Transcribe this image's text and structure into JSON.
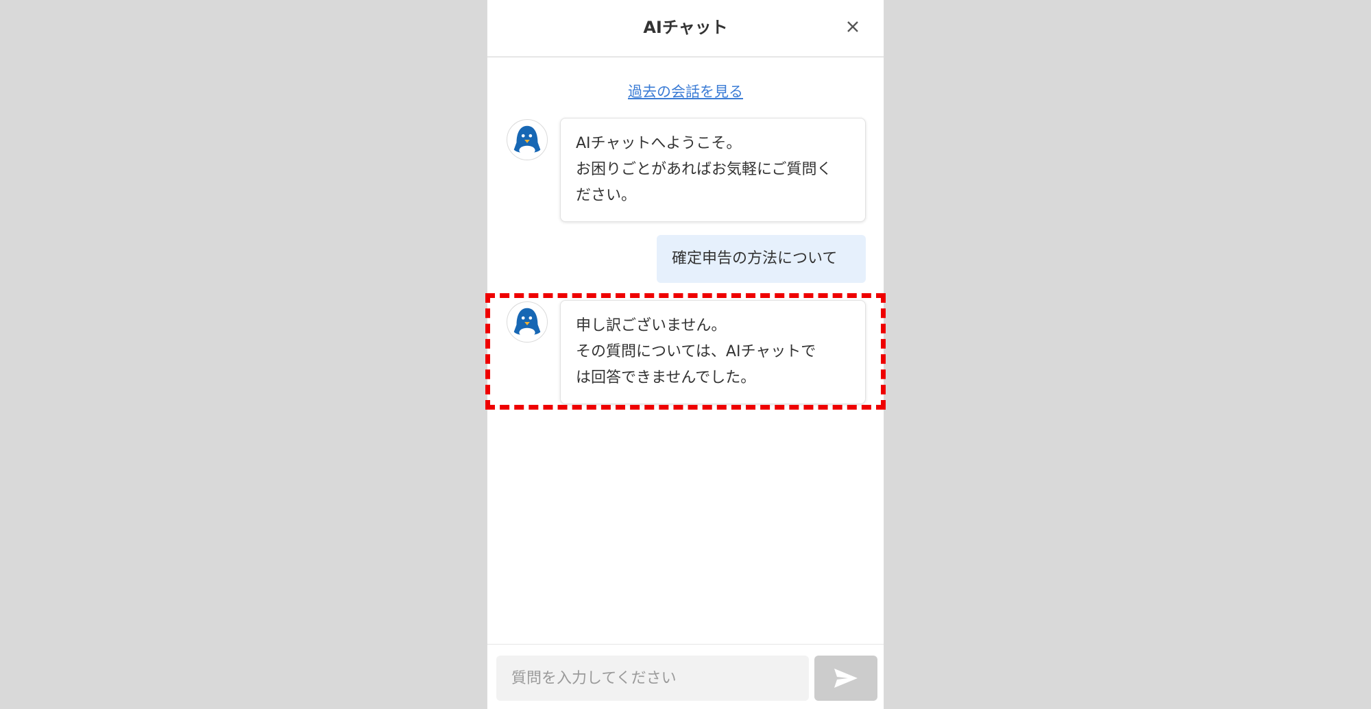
{
  "header": {
    "title": "AIチャット",
    "close_icon": "close-icon"
  },
  "history_link": "過去の会話を見る",
  "messages": [
    {
      "role": "bot",
      "avatar_icon": "penguin-avatar-icon",
      "lines": [
        "AIチャットへようこそ。",
        "お困りごとがあればお気軽にご質問く",
        "ださい。"
      ]
    },
    {
      "role": "user",
      "text": "確定申告の方法について"
    },
    {
      "role": "bot",
      "avatar_icon": "penguin-avatar-icon",
      "lines": [
        "申し訳ございません。",
        "その質問については、AIチャットで",
        "は回答できませんでした。"
      ],
      "highlighted": true
    }
  ],
  "input": {
    "placeholder": "質問を入力してください",
    "value": ""
  },
  "send_icon": "send-icon",
  "colors": {
    "link": "#3a7bd5",
    "user_bubble": "#e6f0fc",
    "highlight": "#ee0000",
    "send_button": "#cccccc",
    "avatar_blue": "#1767b4"
  }
}
